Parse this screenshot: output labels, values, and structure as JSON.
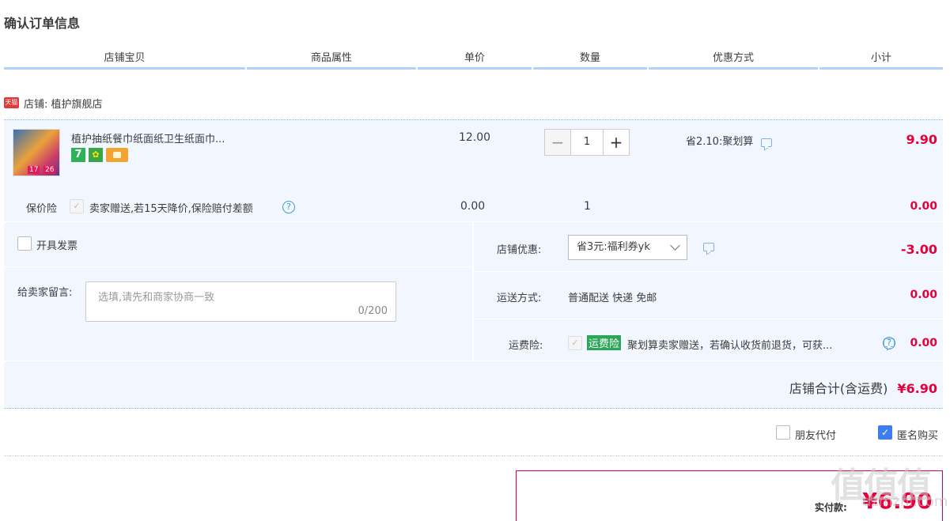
{
  "page_title": "确认订单信息",
  "columns": [
    "店铺宝贝",
    "商品属性",
    "单价",
    "数量",
    "优惠方式",
    "小计"
  ],
  "shop": {
    "badge": "天猫",
    "label": "店铺: 植护旗舰店"
  },
  "item": {
    "thumb_tags": [
      "17",
      "26"
    ],
    "name": "植护抽纸餐巾纸面纸卫生纸面巾...",
    "badges": [
      "7"
    ],
    "unit_price": "12.00",
    "quantity": "1",
    "minus": "−",
    "plus": "+",
    "discount": "省2.10:聚划算",
    "subtotal": "9.90"
  },
  "insurance": {
    "label": "保价险",
    "desc": "卖家赠送,若15天降价,保险赔付差额",
    "price": "0.00",
    "qty": "1",
    "subtotal": "0.00"
  },
  "invoice": {
    "label": "开具发票"
  },
  "message": {
    "label": "给卖家留言:",
    "placeholder": "选填,请先和商家协商一致",
    "count": "0/200"
  },
  "shop_discount": {
    "label": "店铺优惠:",
    "selected": "省3元:福利券yk",
    "amount": "-3.00"
  },
  "shipping": {
    "label": "运送方式:",
    "value": "普通配送 快递 免邮",
    "amount": "0.00"
  },
  "freight_insurance": {
    "label": "运费险:",
    "tag": "运费险",
    "desc": "聚划算卖家赠送，若确认收货前退货，可获...",
    "amount": "0.00"
  },
  "shop_total": {
    "label": "店铺合计(含运费)",
    "value": "¥6.90"
  },
  "options": {
    "friend_pay": "朋友代付",
    "anonymous": "匿名购买"
  },
  "payment": {
    "label": "实付款:",
    "value": "¥6.90"
  },
  "watermark": {
    "big": "值值值",
    "small": "dzmzhi.com"
  },
  "colors": {
    "accent": "#e4003a",
    "panel": "#f2f7ff",
    "header_line": "#b2d1ff",
    "check": "#3c7ef0"
  }
}
